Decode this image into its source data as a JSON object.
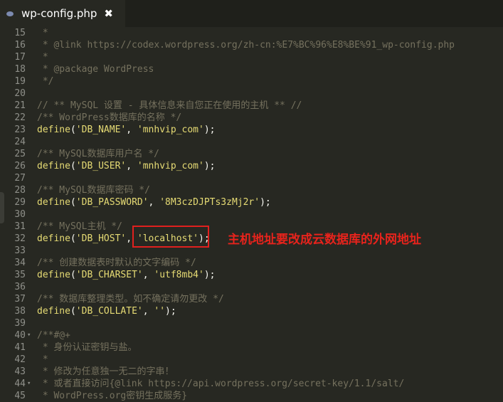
{
  "tab": {
    "title": "wp-config.php",
    "close_glyph": "✖"
  },
  "annotation": "主机地址要改成云数据库的外网地址",
  "lines": [
    {
      "num": "15",
      "fold": "",
      "segs": [
        {
          "cls": "c",
          "text": " *"
        }
      ]
    },
    {
      "num": "16",
      "fold": "",
      "segs": [
        {
          "cls": "c",
          "text": " * @link https://codex.wordpress.org/zh-cn:%E7%BC%96%E8%BE%91_wp-config.php"
        }
      ]
    },
    {
      "num": "17",
      "fold": "",
      "segs": [
        {
          "cls": "c",
          "text": " *"
        }
      ]
    },
    {
      "num": "18",
      "fold": "",
      "segs": [
        {
          "cls": "c",
          "text": " * @package WordPress"
        }
      ]
    },
    {
      "num": "19",
      "fold": "",
      "segs": [
        {
          "cls": "c",
          "text": " */"
        }
      ]
    },
    {
      "num": "20",
      "fold": "",
      "segs": []
    },
    {
      "num": "21",
      "fold": "",
      "segs": [
        {
          "cls": "c",
          "text": "// ** MySQL 设置 - 具体信息来自您正在使用的主机 ** //"
        }
      ]
    },
    {
      "num": "22",
      "fold": "",
      "segs": [
        {
          "cls": "c",
          "text": "/** WordPress数据库的名称 */"
        }
      ]
    },
    {
      "num": "23",
      "fold": "",
      "segs": [
        {
          "cls": "kw",
          "text": "define"
        },
        {
          "cls": "p",
          "text": "("
        },
        {
          "cls": "s",
          "text": "'DB_NAME'"
        },
        {
          "cls": "p",
          "text": ", "
        },
        {
          "cls": "s",
          "text": "'mnhvip_com'"
        },
        {
          "cls": "p",
          "text": ");"
        }
      ]
    },
    {
      "num": "24",
      "fold": "",
      "segs": []
    },
    {
      "num": "25",
      "fold": "",
      "segs": [
        {
          "cls": "c",
          "text": "/** MySQL数据库用户名 */"
        }
      ]
    },
    {
      "num": "26",
      "fold": "",
      "segs": [
        {
          "cls": "kw",
          "text": "define"
        },
        {
          "cls": "p",
          "text": "("
        },
        {
          "cls": "s",
          "text": "'DB_USER'"
        },
        {
          "cls": "p",
          "text": ", "
        },
        {
          "cls": "s",
          "text": "'mnhvip_com'"
        },
        {
          "cls": "p",
          "text": ");"
        }
      ]
    },
    {
      "num": "27",
      "fold": "",
      "segs": []
    },
    {
      "num": "28",
      "fold": "",
      "segs": [
        {
          "cls": "c",
          "text": "/** MySQL数据库密码 */"
        }
      ]
    },
    {
      "num": "29",
      "fold": "",
      "segs": [
        {
          "cls": "kw",
          "text": "define"
        },
        {
          "cls": "p",
          "text": "("
        },
        {
          "cls": "s",
          "text": "'DB_PASSWORD'"
        },
        {
          "cls": "p",
          "text": ", "
        },
        {
          "cls": "s",
          "text": "'8M3czDJPTs3zMj2r'"
        },
        {
          "cls": "p",
          "text": ");"
        }
      ]
    },
    {
      "num": "30",
      "fold": "",
      "segs": []
    },
    {
      "num": "31",
      "fold": "",
      "segs": [
        {
          "cls": "c",
          "text": "/** MySQL主机 */"
        }
      ]
    },
    {
      "num": "32",
      "fold": "",
      "segs": [
        {
          "cls": "kw",
          "text": "define"
        },
        {
          "cls": "p",
          "text": "("
        },
        {
          "cls": "s",
          "text": "'DB_HOST'"
        },
        {
          "cls": "p",
          "text": ", "
        },
        {
          "cls": "s",
          "text": "'localhost'"
        },
        {
          "cls": "p",
          "text": ");"
        }
      ]
    },
    {
      "num": "33",
      "fold": "",
      "segs": []
    },
    {
      "num": "34",
      "fold": "",
      "segs": [
        {
          "cls": "c",
          "text": "/** 创建数据表时默认的文字编码 */"
        }
      ]
    },
    {
      "num": "35",
      "fold": "",
      "segs": [
        {
          "cls": "kw",
          "text": "define"
        },
        {
          "cls": "p",
          "text": "("
        },
        {
          "cls": "s",
          "text": "'DB_CHARSET'"
        },
        {
          "cls": "p",
          "text": ", "
        },
        {
          "cls": "s",
          "text": "'utf8mb4'"
        },
        {
          "cls": "p",
          "text": ");"
        }
      ]
    },
    {
      "num": "36",
      "fold": "",
      "segs": []
    },
    {
      "num": "37",
      "fold": "",
      "segs": [
        {
          "cls": "c",
          "text": "/** 数据库整理类型。如不确定请勿更改 */"
        }
      ]
    },
    {
      "num": "38",
      "fold": "",
      "segs": [
        {
          "cls": "kw",
          "text": "define"
        },
        {
          "cls": "p",
          "text": "("
        },
        {
          "cls": "s",
          "text": "'DB_COLLATE'"
        },
        {
          "cls": "p",
          "text": ", "
        },
        {
          "cls": "s",
          "text": "''"
        },
        {
          "cls": "p",
          "text": ");"
        }
      ]
    },
    {
      "num": "39",
      "fold": "",
      "segs": []
    },
    {
      "num": "40",
      "fold": "▾",
      "segs": [
        {
          "cls": "c",
          "text": "/**#@+"
        }
      ]
    },
    {
      "num": "41",
      "fold": "",
      "segs": [
        {
          "cls": "c",
          "text": " * 身份认证密钥与盐。"
        }
      ]
    },
    {
      "num": "42",
      "fold": "",
      "segs": [
        {
          "cls": "c",
          "text": " *"
        }
      ]
    },
    {
      "num": "43",
      "fold": "",
      "segs": [
        {
          "cls": "c",
          "text": " * 修改为任意独一无二的字串！"
        }
      ]
    },
    {
      "num": "44",
      "fold": "▾",
      "segs": [
        {
          "cls": "c",
          "text": " * 或者直接访问{@link https://api.wordpress.org/secret-key/1.1/salt/"
        }
      ]
    },
    {
      "num": "45",
      "fold": "",
      "segs": [
        {
          "cls": "c",
          "text": " * WordPress.org密钥生成服务}"
        }
      ]
    }
  ]
}
